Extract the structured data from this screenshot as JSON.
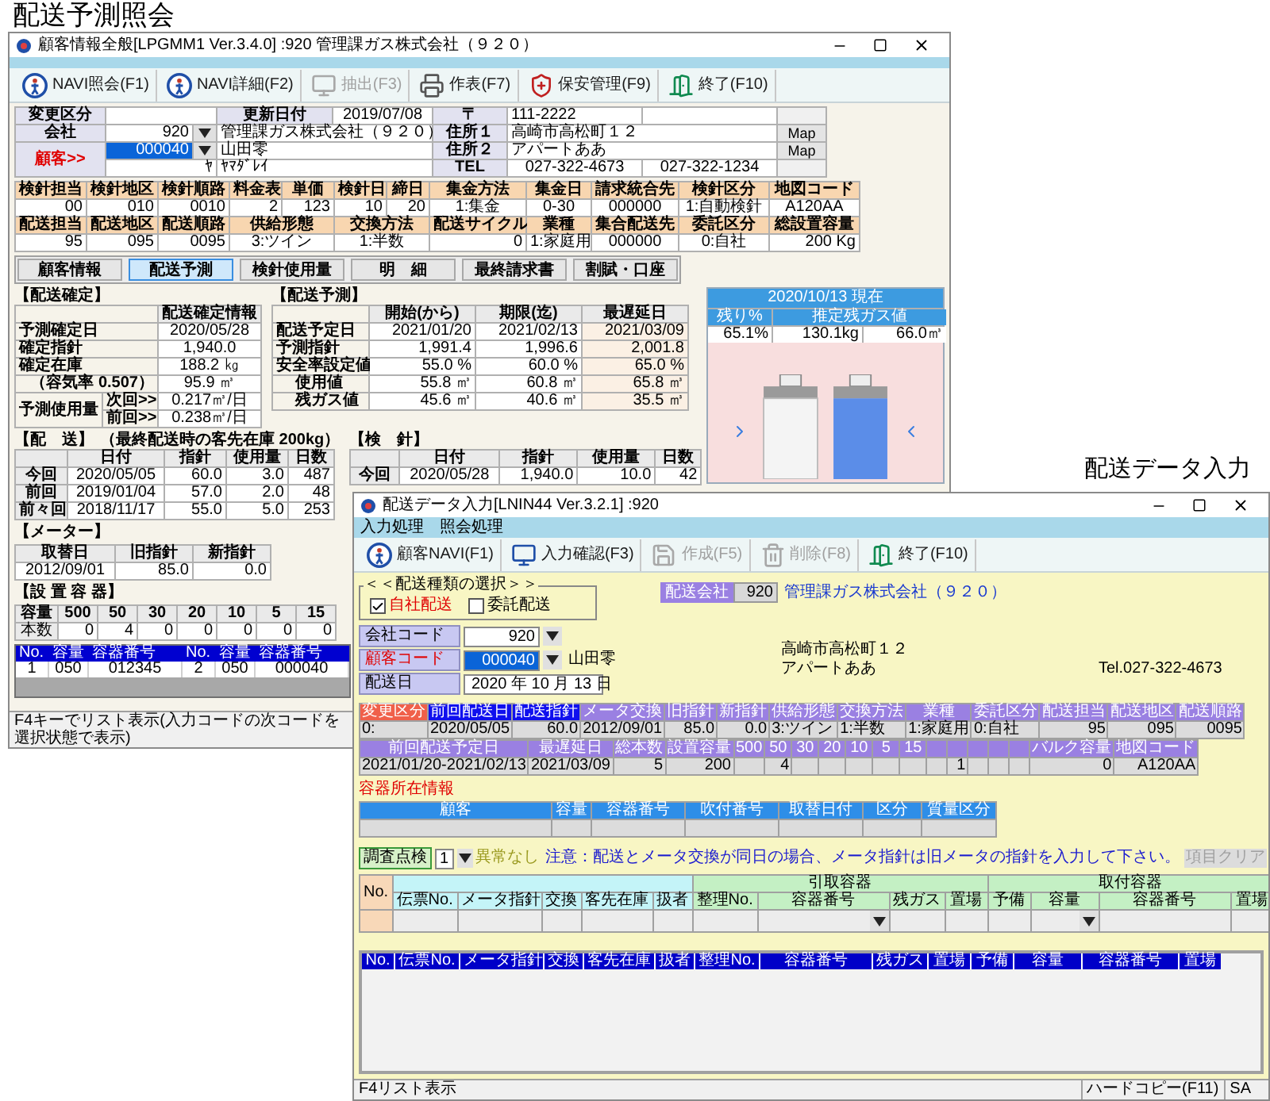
{
  "customer_window": {
    "caption": "配送予測照会",
    "title": "顧客情報全般[LPGMM1 Ver.3.4.0] :920 管理課ガス株式会社（９２０）",
    "toolbar": [
      {
        "label": "NAVI照会(F1)",
        "kind": "navi",
        "disabled": false
      },
      {
        "label": "NAVI詳細(F2)",
        "kind": "navi",
        "disabled": false
      },
      {
        "label": "抽出(F3)",
        "kind": "monitor",
        "disabled": true
      },
      {
        "label": "作表(F7)",
        "kind": "printer",
        "disabled": false
      },
      {
        "label": "保安管理(F9)",
        "kind": "safety",
        "disabled": false
      },
      {
        "label": "終了(F10)",
        "kind": "exit",
        "disabled": false
      }
    ],
    "header": {
      "change_label": "変更区分",
      "updated_label": "更新日付",
      "updated": "2019/07/08",
      "postal_label": "〒",
      "postal": "111-2222",
      "company_label": "会社",
      "company_code": "920",
      "company_name": "管理課ガス株式会社（９２０）",
      "address1_label": "住所１",
      "address1": "高崎市高松町１２",
      "map_buttons": [
        "Map",
        "Map"
      ],
      "customer_label": "顧客>>",
      "customer_code": "000040",
      "code_highlighted": true,
      "customer_name": "山田零",
      "address2_label": "住所２",
      "address2": "アパートああ",
      "kana_label": "ﾔ",
      "kana_name": "ﾔﾏﾀﾞﾚｲ",
      "tel_label": "TEL",
      "tel1": "027-322-4673",
      "tel2": "027-322-1234"
    },
    "account_rows": [
      [
        {
          "label": "検針担当",
          "value": "00"
        },
        {
          "label": "検針地区",
          "value": "010"
        },
        {
          "label": "検針順路",
          "value": "0010"
        },
        {
          "label": "料金表",
          "value": "2"
        },
        {
          "label": "単価",
          "value": "123"
        },
        {
          "label": "検針日",
          "value": "10"
        },
        {
          "label": "締日",
          "value": "20"
        },
        {
          "label": "集金方法",
          "value": "1:集金"
        },
        {
          "label": "集金日",
          "value": "0-30"
        },
        {
          "label": "請求統合先",
          "value": "000000"
        },
        {
          "label": "検針区分",
          "value": "1:自動検針"
        },
        {
          "label": "地図コード",
          "value": "A120AA"
        }
      ],
      [
        {
          "label": "配送担当",
          "value": "95"
        },
        {
          "label": "配送地区",
          "value": "095"
        },
        {
          "label": "配送順路",
          "value": "0095"
        },
        {
          "label": "供給形態",
          "value": "3:ツイン"
        },
        {
          "label": "交換方法",
          "value": "1:半数"
        },
        {
          "label": "配送サイクル",
          "value": "0"
        },
        {
          "label": "業種",
          "value": "1:家庭用"
        },
        {
          "label": "集合配送先",
          "value": "000000"
        },
        {
          "label": "委託区分",
          "value": "0:自社"
        },
        {
          "label": "総設置容量",
          "value": "200 Kg"
        }
      ]
    ],
    "tabs": [
      {
        "label": "顧客情報",
        "selected": false
      },
      {
        "label": "配送予測",
        "selected": true
      },
      {
        "label": "検針使用量",
        "selected": false
      },
      {
        "label": "明　細",
        "selected": false
      },
      {
        "label": "最終請求書",
        "selected": false
      },
      {
        "label": "割賦・口座",
        "selected": false
      }
    ],
    "confirmed": {
      "title": "【配送確定】",
      "header": "配送確定情報",
      "rows": [
        {
          "label": "予測確定日",
          "value": "2020/05/28"
        },
        {
          "label": "確定指針",
          "value": "1,940.0"
        },
        {
          "label": "確定在庫",
          "value": "188.2 ㎏"
        },
        {
          "label": "（容気率 0.507）",
          "value": "95.9 ㎥"
        }
      ],
      "usage": {
        "label": "予測使用量",
        "rows": [
          {
            "sub": "次回>>",
            "value": "0.217㎥/日"
          },
          {
            "sub": "前回>>",
            "value": "0.238㎥/日"
          }
        ]
      }
    },
    "forecast": {
      "title": "【配送予測】",
      "columns": [
        "開始(から)",
        "期限(迄)",
        "最遅延日"
      ],
      "rows": [
        {
          "label": "配送予定日",
          "kind": "main",
          "values": [
            "2021/01/20",
            "2021/02/13",
            "2021/03/09"
          ]
        },
        {
          "label": "予測指針",
          "kind": "main",
          "values": [
            "1,991.4",
            "1,996.6",
            "2,001.8"
          ]
        },
        {
          "label": "安全率設定値",
          "kind": "main",
          "values": [
            "55.0 %",
            "60.0 %",
            "65.0 %"
          ]
        },
        {
          "label": "使用値",
          "kind": "sub",
          "values": [
            "55.8 ㎥",
            "60.8 ㎥",
            "65.8 ㎥"
          ]
        },
        {
          "label": "残ガス値",
          "kind": "sub",
          "values": [
            "45.6 ㎥",
            "40.6 ㎥",
            "35.5 ㎥"
          ]
        }
      ]
    },
    "cylinder_panel": {
      "date": "2020/10/13 現在",
      "columns": [
        "残り%",
        "推定残ガス値"
      ],
      "values": [
        "65.1%",
        "130.1kg",
        "66.0㎥"
      ]
    },
    "delivery": {
      "title": "【配　送】",
      "note": "（最終配送時の客先在庫 200kg）",
      "columns": [
        "日付",
        "指針",
        "使用量",
        "日数"
      ],
      "rows": [
        {
          "label": "今回",
          "values": [
            "2020/05/05",
            "60.0",
            "3.0",
            "487"
          ]
        },
        {
          "label": "前回",
          "values": [
            "2019/01/04",
            "57.0",
            "2.0",
            "48"
          ]
        },
        {
          "label": "前々回",
          "values": [
            "2018/11/17",
            "55.0",
            "5.0",
            "253"
          ]
        }
      ]
    },
    "reading": {
      "title": "【検　針】",
      "columns": [
        "日付",
        "指針",
        "使用量",
        "日数"
      ],
      "rows": [
        {
          "label": "今回",
          "values": [
            "2020/05/28",
            "1,940.0",
            "10.0",
            "42"
          ]
        }
      ]
    },
    "meter": {
      "title": "【メーター】",
      "columns": [
        "取替日",
        "旧指針",
        "新指針"
      ],
      "values": [
        "2012/09/01",
        "85.0",
        "0.0"
      ]
    },
    "containers": {
      "title": "【設 置 容 器】",
      "row_labels": [
        "容量",
        "本数"
      ],
      "columns": [
        {
          "size": "500",
          "count": "0"
        },
        {
          "size": "50",
          "count": "4"
        },
        {
          "size": "30",
          "count": "0"
        },
        {
          "size": "20",
          "count": "0"
        },
        {
          "size": "10",
          "count": "0"
        },
        {
          "size": "5",
          "count": "0"
        },
        {
          "size": "15",
          "count": "0"
        }
      ]
    },
    "container_list": {
      "columns": [
        "No.",
        "容量",
        "容器番号",
        "No.",
        "容量",
        "容器番号"
      ],
      "rows": [
        [
          "1",
          "050",
          "012345",
          "2",
          "050",
          "000040"
        ]
      ]
    },
    "status": "F4キーでリスト表示(入力コードの次コードを選択状態で表示)"
  },
  "delivery_window": {
    "caption": "配送データ入力",
    "title": "配送データ入力[LNIN44 Ver.3.2.1] :920",
    "menu": [
      "入力処理",
      "照会処理"
    ],
    "toolbar": [
      {
        "label": "顧客NAVI(F1)",
        "kind": "navi",
        "disabled": false
      },
      {
        "label": "入力確認(F3)",
        "kind": "monitor",
        "disabled": false
      },
      {
        "label": "作成(F5)",
        "kind": "save",
        "disabled": true
      },
      {
        "label": "削除(F8)",
        "kind": "trash",
        "disabled": true
      },
      {
        "label": "終了(F10)",
        "kind": "exit",
        "disabled": false
      }
    ],
    "type_group": {
      "title": "＜＜配送種類の選択＞＞",
      "options": [
        {
          "label": "自社配送",
          "checked": true
        },
        {
          "label": "委託配送",
          "checked": false
        }
      ]
    },
    "delivery_company": {
      "label": "配送会社",
      "code": "920",
      "name": "管理課ガス株式会社（９２０）"
    },
    "fields": {
      "company_label": "会社コード",
      "company_code": "920",
      "customer_label": "顧客コード",
      "customer_code": "000040",
      "code_highlighted": true,
      "customer_name": "山田零",
      "date_label": "配送日",
      "date": "2020 年 10 月 13 日"
    },
    "address": {
      "line1": "高崎市高松町１２",
      "line2": "アパートああ",
      "tel": "Tel.027-322-4673"
    },
    "grid1": [
      {
        "label": "変更区分",
        "value": "0:",
        "kind": "alert"
      },
      {
        "label": "前回配送日",
        "value": "2020/05/05",
        "kind": "key"
      },
      {
        "label": "配送指針",
        "value": "60.0",
        "kind": "key"
      },
      {
        "label": "メータ交換",
        "value": "2012/09/01",
        "kind": "field"
      },
      {
        "label": "旧指針",
        "value": "85.0",
        "kind": "field"
      },
      {
        "label": "新指針",
        "value": "0.0",
        "kind": "field"
      },
      {
        "label": "供給形態",
        "value": "3:ツイン",
        "kind": "field"
      },
      {
        "label": "交換方法",
        "value": "1:半数",
        "kind": "field"
      },
      {
        "label": "業種",
        "value": "1:家庭用",
        "kind": "field"
      },
      {
        "label": "委託区分",
        "value": "0:自社",
        "kind": "field"
      },
      {
        "label": "配送担当",
        "value": "95",
        "kind": "field"
      },
      {
        "label": "配送地区",
        "value": "095",
        "kind": "field"
      },
      {
        "label": "配送順路",
        "value": "0095",
        "kind": "field"
      }
    ],
    "grid2": [
      {
        "label": "前回配送予定日",
        "value": "2021/01/20-2021/02/13",
        "kind": "field"
      },
      {
        "label": "最遅延日",
        "value": "2021/03/09",
        "kind": "field"
      },
      {
        "label": "総本数",
        "value": "5",
        "kind": "field"
      },
      {
        "label": "設置容量",
        "value": "200",
        "kind": "field"
      },
      {
        "label": "500",
        "kind": "size"
      },
      {
        "label": "50",
        "value": "4",
        "kind": "size"
      },
      {
        "label": "30",
        "kind": "size"
      },
      {
        "label": "20",
        "kind": "size"
      },
      {
        "label": "10",
        "kind": "size"
      },
      {
        "label": "5",
        "kind": "size"
      },
      {
        "label": "15",
        "kind": "size"
      },
      {
        "kind": "spare"
      },
      {
        "value": "1",
        "kind": "spare"
      },
      {
        "kind": "spare"
      },
      {
        "kind": "spare"
      },
      {
        "kind": "spare"
      },
      {
        "label": "バルク容量",
        "value": "0",
        "kind": "field"
      },
      {
        "label": "地図コード",
        "value": "A120AA",
        "kind": "field"
      }
    ],
    "container_location": {
      "title": "容器所在情報",
      "columns": [
        "顧客",
        "容量",
        "容器番号",
        "吹付番号",
        "取替日付",
        "区分",
        "質量区分"
      ]
    },
    "inspection": {
      "label": "調査点検",
      "value": "1",
      "result": "異常なし",
      "notice": "注意：配送とメータ交換が同日の場合、メータ指針は旧メータの指針を入力して下さい。",
      "clear_button": {
        "label": "項目クリア",
        "disabled": true
      }
    },
    "entry_grid": {
      "no_label": "No.",
      "groups": [
        {
          "columns": [
            {
              "label": "伝票No.",
              "dropdown": false
            },
            {
              "label": "メータ指針",
              "dropdown": false
            },
            {
              "label": "交換",
              "dropdown": false
            },
            {
              "label": "客先在庫",
              "dropdown": false
            },
            {
              "label": "扱者",
              "dropdown": false
            }
          ]
        },
        {
          "title": "引取容器",
          "columns": [
            {
              "label": "整理No.",
              "dropdown": false
            },
            {
              "label": "容器番号",
              "dropdown": true
            },
            {
              "label": "残ガス",
              "dropdown": false
            },
            {
              "label": "置場",
              "dropdown": false
            }
          ]
        },
        {
          "title": "取付容器",
          "columns": [
            {
              "label": "予備",
              "dropdown": false
            },
            {
              "label": "容量",
              "dropdown": true
            },
            {
              "label": "容器番号",
              "dropdown": false
            },
            {
              "label": "置場",
              "dropdown": false
            }
          ]
        }
      ]
    },
    "list": {
      "columns": [
        "No.",
        "伝票No.",
        "メータ指針",
        "交換",
        "客先在庫",
        "扱者",
        "整理No.",
        "容器番号",
        "残ガス",
        "置場",
        "予備",
        "容量",
        "容器番号",
        "置場"
      ]
    },
    "status": {
      "text": "F4リスト表示",
      "hard_copy": "ハードコピー(F11)",
      "mode": "SA"
    }
  }
}
